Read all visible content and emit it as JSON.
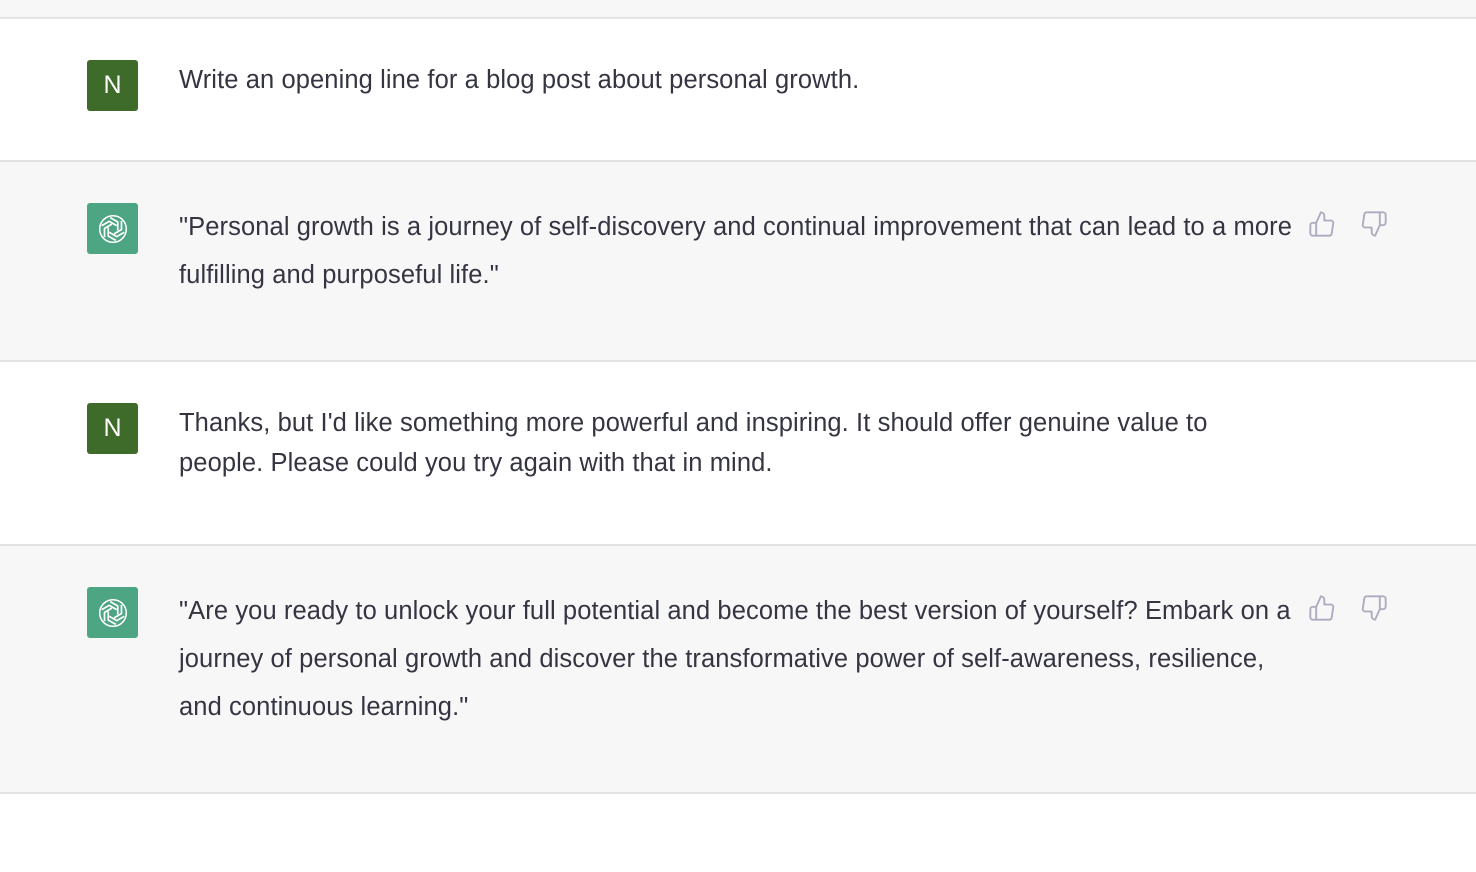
{
  "conversation": {
    "messages": [
      {
        "role": "user",
        "avatar_letter": "N",
        "text": "Write an opening line for a blog post about personal growth."
      },
      {
        "role": "assistant",
        "avatar_icon": "openai-logo-icon",
        "text": "\"Personal growth is a journey of self-discovery and continual improvement that can lead to a more fulfilling and purposeful life.\""
      },
      {
        "role": "user",
        "avatar_letter": "N",
        "text": "Thanks, but I'd like something more powerful and inspiring. It should offer genuine value to people. Please could you try again with that in mind."
      },
      {
        "role": "assistant",
        "avatar_icon": "openai-logo-icon",
        "text": "\"Are you ready to unlock your full potential and become the best version of yourself? Embark on a journey of personal growth and discover the transformative power of self-awareness, resilience, and continuous learning.\""
      }
    ]
  },
  "feedback_icons": [
    "thumbs-up-icon",
    "thumbs-down-icon"
  ],
  "colors": {
    "user_avatar": "#3f6b2a",
    "assistant_avatar": "#4ea584",
    "assistant_row_bg": "#f7f7f8",
    "text": "#343541",
    "icon": "#acacbe"
  }
}
